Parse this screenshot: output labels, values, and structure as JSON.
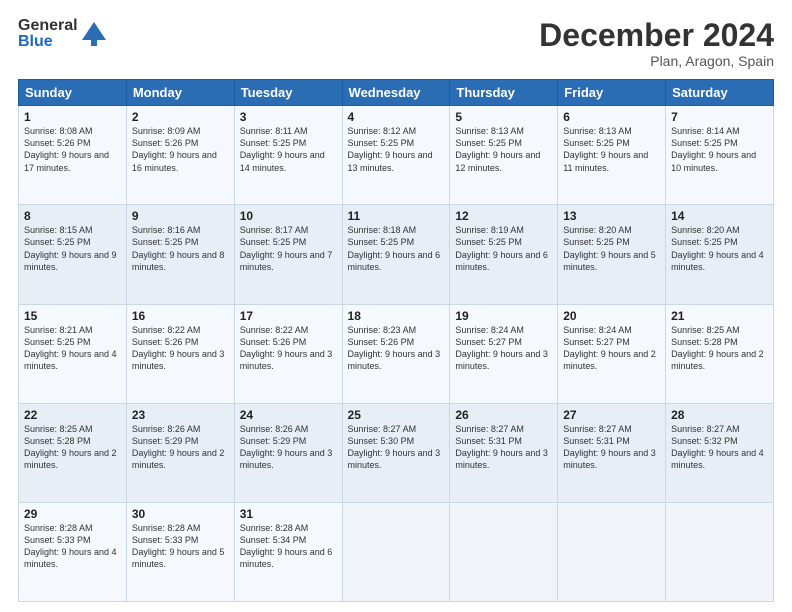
{
  "logo": {
    "general": "General",
    "blue": "Blue"
  },
  "title": "December 2024",
  "location": "Plan, Aragon, Spain",
  "days_of_week": [
    "Sunday",
    "Monday",
    "Tuesday",
    "Wednesday",
    "Thursday",
    "Friday",
    "Saturday"
  ],
  "weeks": [
    [
      {
        "day": "1",
        "sunrise": "8:08 AM",
        "sunset": "5:26 PM",
        "daylight": "9 hours and 17 minutes."
      },
      {
        "day": "2",
        "sunrise": "8:09 AM",
        "sunset": "5:26 PM",
        "daylight": "9 hours and 16 minutes."
      },
      {
        "day": "3",
        "sunrise": "8:11 AM",
        "sunset": "5:25 PM",
        "daylight": "9 hours and 14 minutes."
      },
      {
        "day": "4",
        "sunrise": "8:12 AM",
        "sunset": "5:25 PM",
        "daylight": "9 hours and 13 minutes."
      },
      {
        "day": "5",
        "sunrise": "8:13 AM",
        "sunset": "5:25 PM",
        "daylight": "9 hours and 12 minutes."
      },
      {
        "day": "6",
        "sunrise": "8:13 AM",
        "sunset": "5:25 PM",
        "daylight": "9 hours and 11 minutes."
      },
      {
        "day": "7",
        "sunrise": "8:14 AM",
        "sunset": "5:25 PM",
        "daylight": "9 hours and 10 minutes."
      }
    ],
    [
      {
        "day": "8",
        "sunrise": "8:15 AM",
        "sunset": "5:25 PM",
        "daylight": "9 hours and 9 minutes."
      },
      {
        "day": "9",
        "sunrise": "8:16 AM",
        "sunset": "5:25 PM",
        "daylight": "9 hours and 8 minutes."
      },
      {
        "day": "10",
        "sunrise": "8:17 AM",
        "sunset": "5:25 PM",
        "daylight": "9 hours and 7 minutes."
      },
      {
        "day": "11",
        "sunrise": "8:18 AM",
        "sunset": "5:25 PM",
        "daylight": "9 hours and 6 minutes."
      },
      {
        "day": "12",
        "sunrise": "8:19 AM",
        "sunset": "5:25 PM",
        "daylight": "9 hours and 6 minutes."
      },
      {
        "day": "13",
        "sunrise": "8:20 AM",
        "sunset": "5:25 PM",
        "daylight": "9 hours and 5 minutes."
      },
      {
        "day": "14",
        "sunrise": "8:20 AM",
        "sunset": "5:25 PM",
        "daylight": "9 hours and 4 minutes."
      }
    ],
    [
      {
        "day": "15",
        "sunrise": "8:21 AM",
        "sunset": "5:25 PM",
        "daylight": "9 hours and 4 minutes."
      },
      {
        "day": "16",
        "sunrise": "8:22 AM",
        "sunset": "5:26 PM",
        "daylight": "9 hours and 3 minutes."
      },
      {
        "day": "17",
        "sunrise": "8:22 AM",
        "sunset": "5:26 PM",
        "daylight": "9 hours and 3 minutes."
      },
      {
        "day": "18",
        "sunrise": "8:23 AM",
        "sunset": "5:26 PM",
        "daylight": "9 hours and 3 minutes."
      },
      {
        "day": "19",
        "sunrise": "8:24 AM",
        "sunset": "5:27 PM",
        "daylight": "9 hours and 3 minutes."
      },
      {
        "day": "20",
        "sunrise": "8:24 AM",
        "sunset": "5:27 PM",
        "daylight": "9 hours and 2 minutes."
      },
      {
        "day": "21",
        "sunrise": "8:25 AM",
        "sunset": "5:28 PM",
        "daylight": "9 hours and 2 minutes."
      }
    ],
    [
      {
        "day": "22",
        "sunrise": "8:25 AM",
        "sunset": "5:28 PM",
        "daylight": "9 hours and 2 minutes."
      },
      {
        "day": "23",
        "sunrise": "8:26 AM",
        "sunset": "5:29 PM",
        "daylight": "9 hours and 2 minutes."
      },
      {
        "day": "24",
        "sunrise": "8:26 AM",
        "sunset": "5:29 PM",
        "daylight": "9 hours and 3 minutes."
      },
      {
        "day": "25",
        "sunrise": "8:27 AM",
        "sunset": "5:30 PM",
        "daylight": "9 hours and 3 minutes."
      },
      {
        "day": "26",
        "sunrise": "8:27 AM",
        "sunset": "5:31 PM",
        "daylight": "9 hours and 3 minutes."
      },
      {
        "day": "27",
        "sunrise": "8:27 AM",
        "sunset": "5:31 PM",
        "daylight": "9 hours and 3 minutes."
      },
      {
        "day": "28",
        "sunrise": "8:27 AM",
        "sunset": "5:32 PM",
        "daylight": "9 hours and 4 minutes."
      }
    ],
    [
      {
        "day": "29",
        "sunrise": "8:28 AM",
        "sunset": "5:33 PM",
        "daylight": "9 hours and 4 minutes."
      },
      {
        "day": "30",
        "sunrise": "8:28 AM",
        "sunset": "5:33 PM",
        "daylight": "9 hours and 5 minutes."
      },
      {
        "day": "31",
        "sunrise": "8:28 AM",
        "sunset": "5:34 PM",
        "daylight": "9 hours and 6 minutes."
      },
      null,
      null,
      null,
      null
    ]
  ],
  "labels": {
    "sunrise": "Sunrise:",
    "sunset": "Sunset:",
    "daylight": "Daylight:"
  }
}
